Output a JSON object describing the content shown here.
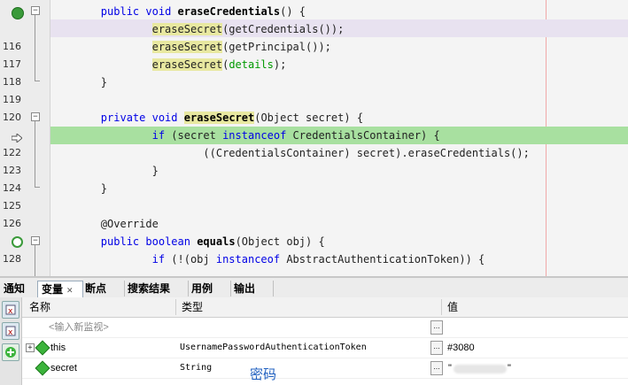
{
  "editor": {
    "lines": [
      {
        "num": "",
        "html": "<span class='kw'>public</span> <span class='kw'>void</span> <span class='b'>eraseCredentials</span>() {"
      },
      {
        "num": "",
        "html": "        <span class='mh'>eraseSecret</span>(getCredentials());"
      },
      {
        "num": "116",
        "html": "        <span class='mh'>eraseSecret</span>(getPrincipal());"
      },
      {
        "num": "117",
        "html": "        <span class='mh'>eraseSecret</span>(<span class='field'>details</span>);"
      },
      {
        "num": "118",
        "html": "}"
      },
      {
        "num": "119",
        "html": ""
      },
      {
        "num": "120",
        "html": "<span class='kw'>private</span> <span class='kw'>void</span> <span class='mhb'>eraseSecret</span>(Object secret) {"
      },
      {
        "num": "",
        "html": "        <span class='kw'>if</span> (secret <span class='kw'>instanceof</span> CredentialsContainer) {"
      },
      {
        "num": "122",
        "html": "                ((CredentialsContainer) secret).eraseCredentials();"
      },
      {
        "num": "123",
        "html": "        }"
      },
      {
        "num": "124",
        "html": "}"
      },
      {
        "num": "125",
        "html": ""
      },
      {
        "num": "126",
        "html": "<span class='ann'>@Override</span>"
      },
      {
        "num": "",
        "html": "<span class='kw'>public</span> <span class='kw'>boolean</span> <span class='b'>equals</span>(Object obj) {"
      },
      {
        "num": "128",
        "html": "        <span class='kw'>if</span> (!(obj <span class='kw'>instanceof</span> AbstractAuthenticationToken)) {"
      }
    ]
  },
  "tabs": [
    {
      "label": "通知"
    },
    {
      "label": "变量",
      "close": "✕"
    },
    {
      "label": "断点"
    },
    {
      "label": "搜索结果"
    },
    {
      "label": "用例"
    },
    {
      "label": "输出"
    }
  ],
  "variables": {
    "columns": {
      "name": "名称",
      "type": "类型",
      "value": "值"
    },
    "watch_placeholder": "<输入新监视>",
    "rows": [
      {
        "name": "this",
        "type": "UsernamePasswordAuthenticationToken",
        "value": "#3080"
      },
      {
        "name": "secret",
        "type": "String",
        "value_open": "\"",
        "value_close": "\""
      }
    ],
    "dots": "..."
  },
  "overlay_text": "密码",
  "colors": {
    "current_line": "#a8e0a0",
    "keyword": "#0000e6",
    "mark_occurrence": "#e8e8a0"
  }
}
